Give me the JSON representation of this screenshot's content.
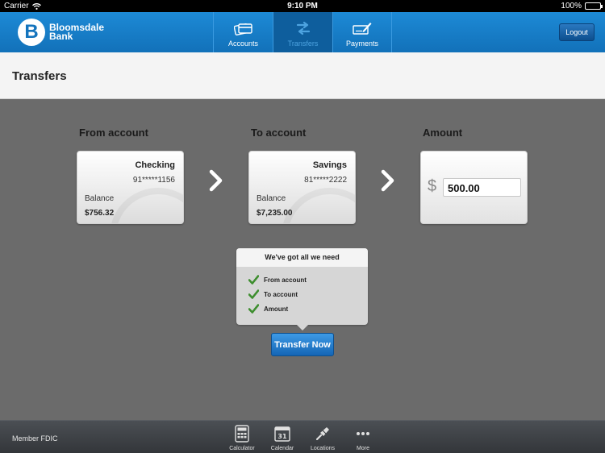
{
  "status": {
    "carrier": "Carrier",
    "time": "9:10 PM",
    "battery": "100%"
  },
  "brand": {
    "letter": "B",
    "line1": "Bloomsdale",
    "line2": "Bank"
  },
  "nav": {
    "tabs": [
      {
        "label": "Accounts",
        "icon": "accounts-icon"
      },
      {
        "label": "Transfers",
        "icon": "transfers-icon"
      },
      {
        "label": "Payments",
        "icon": "payments-icon"
      }
    ],
    "active_tab": "Transfers",
    "logout": "Logout"
  },
  "page": {
    "title": "Transfers"
  },
  "from": {
    "label": "From account",
    "name": "Checking",
    "number": "91*****1156",
    "balance_label": "Balance",
    "balance": "$756.32"
  },
  "to": {
    "label": "To account",
    "name": "Savings",
    "number": "81*****2222",
    "balance_label": "Balance",
    "balance": "$7,235.00"
  },
  "amount": {
    "label": "Amount",
    "currency": "$",
    "value": "500.00"
  },
  "checklist": {
    "title": "We've got all we need",
    "items": [
      "From account",
      "To account",
      "Amount"
    ]
  },
  "transfer_button": "Transfer Now",
  "footer": {
    "member": "Member FDIC",
    "items": [
      {
        "label": "Calculator",
        "icon": "calculator-icon"
      },
      {
        "label": "Calendar",
        "icon": "calendar-icon",
        "day": "31"
      },
      {
        "label": "Locations",
        "icon": "locations-icon"
      },
      {
        "label": "More",
        "icon": "more-icon"
      }
    ]
  },
  "colors": {
    "brand_blue": "#1474bd",
    "check_green": "#3e8e2f",
    "background": "#6b6b6b"
  }
}
